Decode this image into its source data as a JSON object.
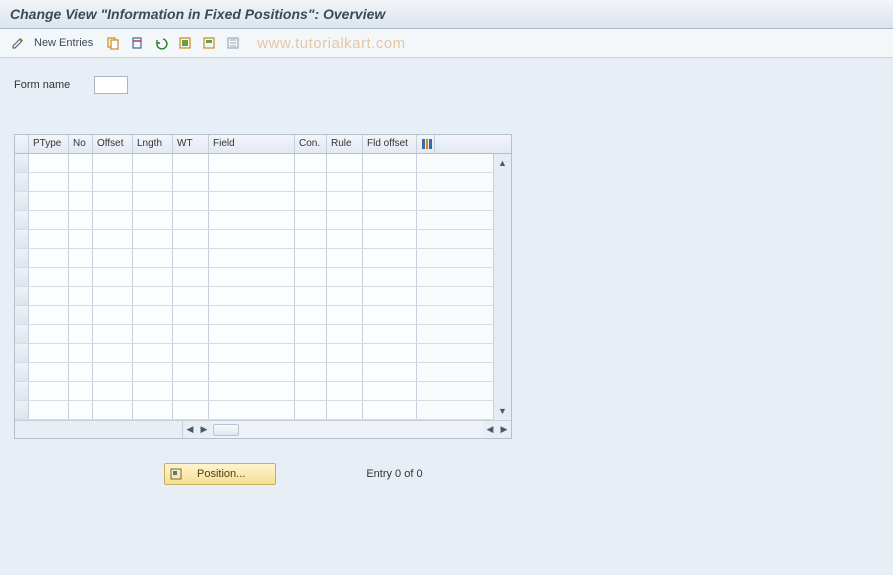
{
  "title": "Change View \"Information in Fixed Positions\": Overview",
  "toolbar": {
    "new_entries": "New Entries"
  },
  "watermark": "www.tutorialkart.com",
  "form": {
    "name_label": "Form name",
    "name_value": ""
  },
  "grid": {
    "columns": {
      "ptype": "PType",
      "no": "No",
      "offset": "Offset",
      "lngth": "Lngth",
      "wt": "WT",
      "field": "Field",
      "con": "Con.",
      "rule": "Rule",
      "fld_offset": "Fld offset"
    },
    "row_count": 14
  },
  "footer": {
    "position_label": "Position...",
    "status": "Entry 0 of 0"
  }
}
